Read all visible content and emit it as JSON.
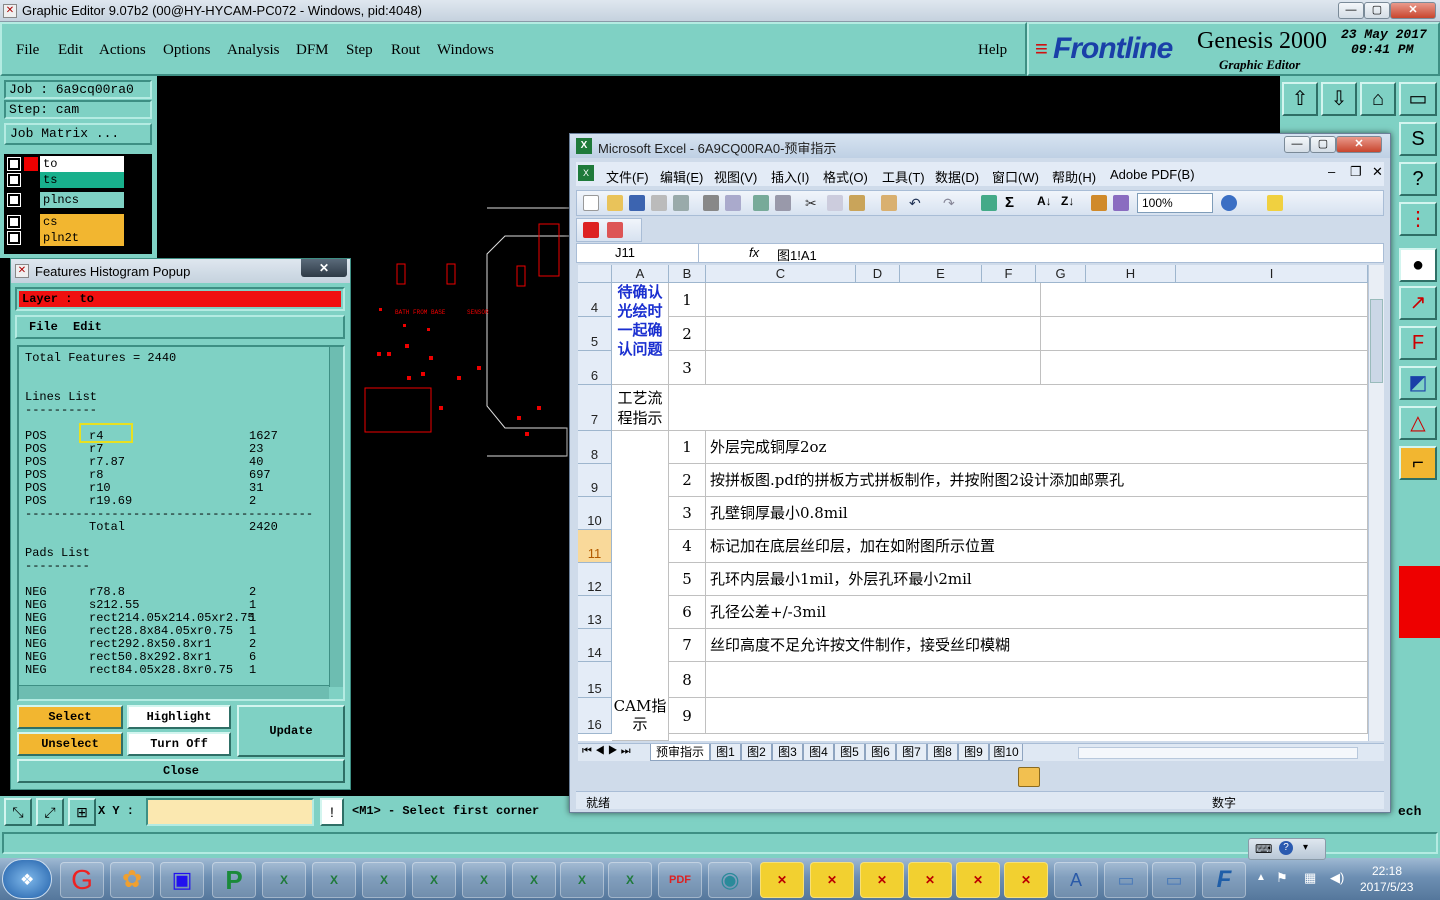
{
  "window": {
    "title": "Graphic Editor 9.07b2 (00@HY-HYCAM-PC072 - Windows, pid:4048)"
  },
  "menu": {
    "items": [
      "File",
      "Edit",
      "Actions",
      "Options",
      "Analysis",
      "DFM",
      "Step",
      "Rout",
      "Windows"
    ],
    "help": "Help"
  },
  "brand": {
    "logo": "Frontline",
    "product": "Genesis 2000",
    "subtitle": "Graphic Editor",
    "date": "23 May 2017",
    "time": "09:41 PM"
  },
  "job": {
    "job": "Job : 6a9cq00ra0",
    "step": "Step: cam",
    "matrix": "Job Matrix ..."
  },
  "layers": [
    {
      "name": "to",
      "color": "#ff2020"
    },
    {
      "name": "ts",
      "color": "#18b08c"
    },
    {
      "name": "plncs",
      "color": "#7fd1c4"
    },
    {
      "name": "cs",
      "color": "#f2b630"
    },
    {
      "name": "pln2t",
      "color": "#f2b630"
    }
  ],
  "histogram": {
    "title": "Features Histogram Popup",
    "layer_label": "Layer :  to",
    "menu": [
      "File",
      "Edit"
    ],
    "total": "Total Features = 2440",
    "lines_title": "Lines List",
    "lines": [
      [
        "POS",
        "r4",
        "1627"
      ],
      [
        "POS",
        "r7",
        "23"
      ],
      [
        "POS",
        "r7.87",
        "40"
      ],
      [
        "POS",
        "r8",
        "697"
      ],
      [
        "POS",
        "r10",
        "31"
      ],
      [
        "POS",
        "r19.69",
        "2"
      ]
    ],
    "lines_total": [
      "Total",
      "2420"
    ],
    "pads_title": "Pads List",
    "pads": [
      [
        "NEG",
        "r78.8",
        "2"
      ],
      [
        "NEG",
        "s212.55",
        "1"
      ],
      [
        "NEG",
        "rect214.05x214.05xr2.75",
        "1"
      ],
      [
        "NEG",
        "rect28.8x84.05xr0.75",
        "1"
      ],
      [
        "NEG",
        "rect292.8x50.8xr1",
        "2"
      ],
      [
        "NEG",
        "rect50.8x292.8xr1",
        "6"
      ],
      [
        "NEG",
        "rect84.05x28.8xr0.75",
        "1"
      ]
    ],
    "buttons": {
      "select": "Select",
      "highlight": "Highlight",
      "update": "Update",
      "unselect": "Unselect",
      "turn_off": "Turn Off",
      "close": "Close"
    }
  },
  "status": {
    "xy_label": "X Y :",
    "prompt": "<M1> - Select first corner",
    "side_text": "ech"
  },
  "canvas_labels": [
    "BATH FROM BASE",
    "SENSOR"
  ],
  "excel": {
    "title": "Microsoft Excel - 6A9CQ00RA0-预审指示",
    "menu": [
      "文件(F)",
      "编辑(E)",
      "视图(V)",
      "插入(I)",
      "格式(O)",
      "工具(T)",
      "数据(D)",
      "窗口(W)",
      "帮助(H)",
      "Adobe PDF(B)"
    ],
    "zoom": "100%",
    "namebox": "J11",
    "fx": "fx",
    "formula": "图1!A1",
    "columns": [
      "A",
      "B",
      "C",
      "D",
      "E",
      "F",
      "G",
      "H",
      "I"
    ],
    "rows": [
      "4",
      "5",
      "6",
      "7",
      "8",
      "9",
      "10",
      "11",
      "12",
      "13",
      "14",
      "15",
      "16"
    ],
    "a_top": "待确认光绘时一起确认问题",
    "a_mid": "工艺流程指示",
    "a_cam": "CAM指示",
    "small_nums": [
      "1",
      "2",
      "3"
    ],
    "instructions": [
      {
        "n": "1",
        "text": "外层完成铜厚2oz"
      },
      {
        "n": "2",
        "text": "按拼板图.pdf的拼板方式拼板制作，并按附图2设计添加邮票孔"
      },
      {
        "n": "3",
        "text": "孔壁铜厚最小0.8mil"
      },
      {
        "n": "4",
        "text": "标记加在底层丝印层，加在如附图所示位置"
      },
      {
        "n": "5",
        "text": "孔环内层最小1mil，外层孔环最小2mil"
      },
      {
        "n": "6",
        "text": "孔径公差+/-3mil"
      },
      {
        "n": "7",
        "text": "丝印高度不足允许按文件制作，接受丝印模糊"
      },
      {
        "n": "8",
        "text": ""
      },
      {
        "n": "9",
        "text": ""
      }
    ],
    "sheets": [
      "预审指示",
      "图1",
      "图2",
      "图3",
      "图4",
      "图5",
      "图6",
      "图7",
      "图8",
      "图9",
      "图10"
    ],
    "status_left": "就绪",
    "status_right": "数字"
  },
  "taskbar": {
    "time": "22:18",
    "date": "2017/5/23"
  }
}
